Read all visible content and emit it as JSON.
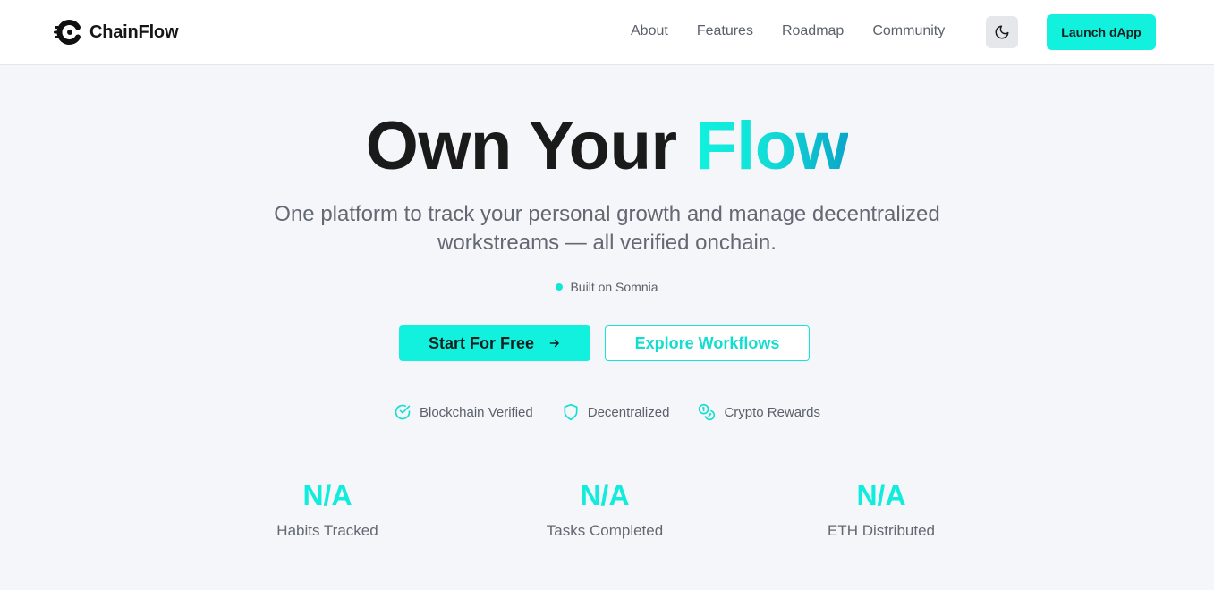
{
  "brand": {
    "name": "ChainFlow",
    "icon": "chainflow-logo-icon"
  },
  "nav": {
    "links": [
      "About",
      "Features",
      "Roadmap",
      "Community"
    ],
    "theme_toggle_icon": "moon-icon",
    "launch_label": "Launch dApp"
  },
  "hero": {
    "title_main": "Own Your",
    "title_accent": "Flow",
    "subtitle": "One platform to track your personal growth and manage decentralized workstreams — all verified onchain.",
    "built_on": "Built on Somnia"
  },
  "cta": {
    "primary_label": "Start For Free",
    "primary_icon": "arrow-right-icon",
    "secondary_label": "Explore Workflows"
  },
  "features": [
    {
      "label": "Blockchain Verified",
      "icon": "check-circle-icon"
    },
    {
      "label": "Decentralized",
      "icon": "shield-icon"
    },
    {
      "label": "Crypto Rewards",
      "icon": "coins-icon"
    }
  ],
  "stats": [
    {
      "value": "N/A",
      "label": "Habits Tracked"
    },
    {
      "value": "N/A",
      "label": "Tasks Completed"
    },
    {
      "value": "N/A",
      "label": "ETH Distributed"
    }
  ],
  "colors": {
    "accent": "#12f1de",
    "accent_dark": "#0aa6c9",
    "background": "#f5f6f9",
    "text": "#1a1a1a",
    "muted": "#5b606a"
  }
}
